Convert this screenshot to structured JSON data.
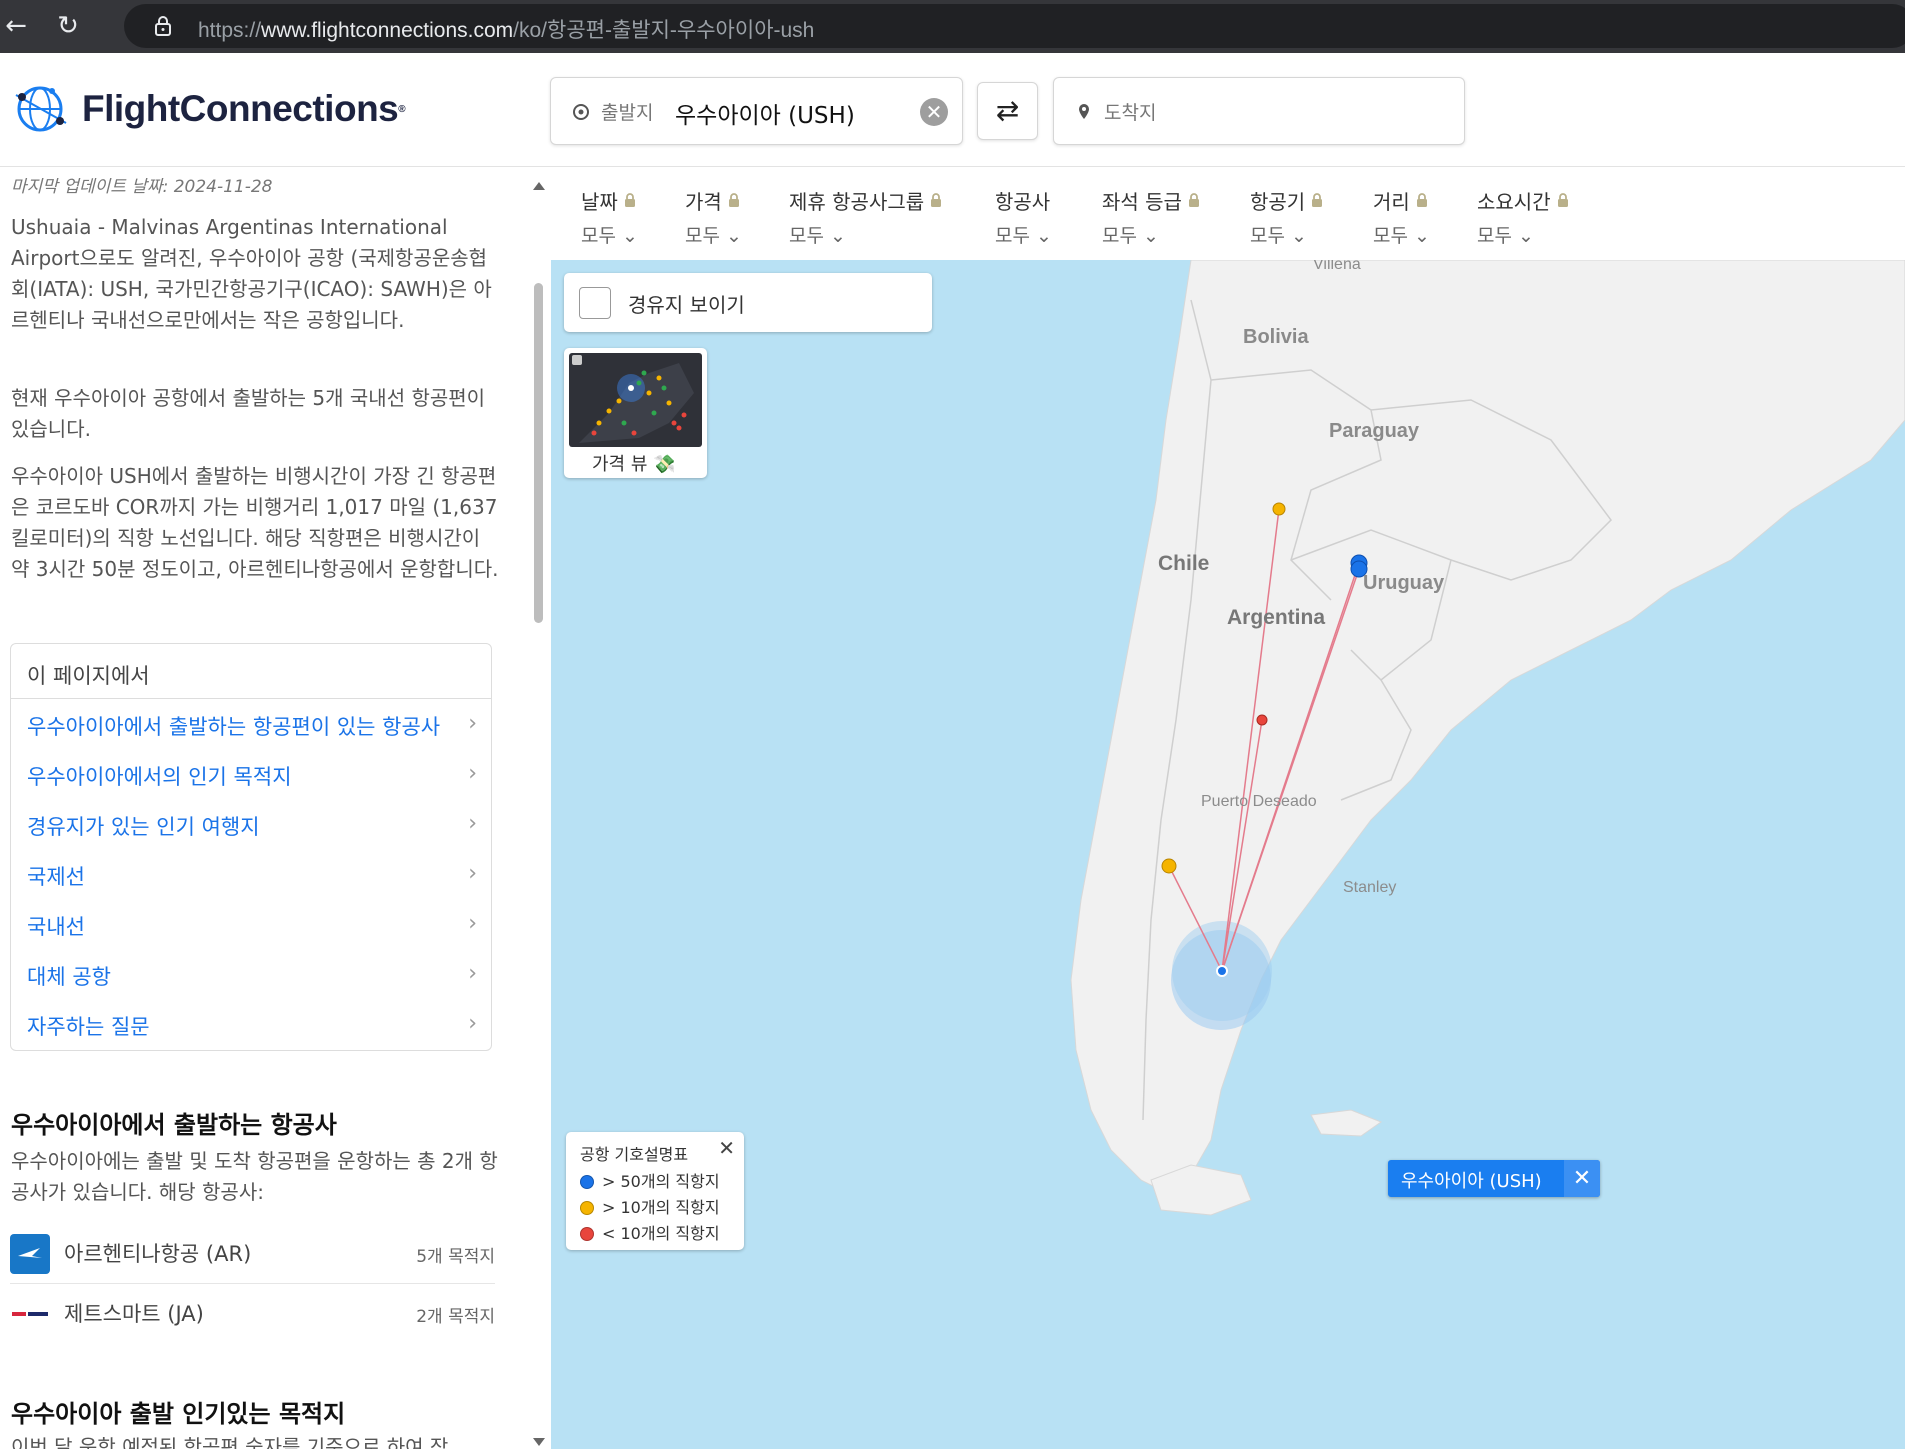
{
  "browser": {
    "url_prefix": "https://",
    "url_host": "www.flightconnections.com",
    "url_path": "/ko/항공편-출발지-우수아이아-ush"
  },
  "header": {
    "logo_text": "FlightConnections",
    "origin_label": "출발지",
    "origin_value": "우수아이아 (USH)",
    "destination_placeholder": "도착지"
  },
  "filters": [
    {
      "name": "날짜",
      "value": "모두",
      "locked": true
    },
    {
      "name": "가격",
      "value": "모두",
      "locked": true
    },
    {
      "name": "제휴 항공사그룹",
      "value": "모두",
      "locked": true
    },
    {
      "name": "항공사",
      "value": "모두",
      "locked": false
    },
    {
      "name": "좌석 등급",
      "value": "모두",
      "locked": true
    },
    {
      "name": "항공기",
      "value": "모두",
      "locked": true
    },
    {
      "name": "거리",
      "value": "모두",
      "locked": true
    },
    {
      "name": "소요시간",
      "value": "모두",
      "locked": true
    }
  ],
  "left": {
    "updated": "마지막 업데이트 날짜: 2024-11-28",
    "intro": "Ushuaia - Malvinas Argentinas International Airport으로도 알려진, 우수아이아 공항 (국제항공운송협회(IATA): USH, 국가민간항공기구(ICAO): SAWH)은 아르헨티나 국내선으로만에서는 작은 공항입니다.",
    "para2": "현재 우수아이아 공항에서 출발하는 5개 국내선 항공편이 있습니다.",
    "para3": "우수아이아 USH에서 출발하는 비행시간이 가장 긴 항공편은 코르도바 COR까지 가는 비행거리 1,017 마일 (1,637 킬로미터)의 직항 노선입니다. 해당 직항편은 비행시간이 약 3시간 50분 정도이고, 아르헨티나항공에서 운항합니다.",
    "toc_title": "이 페이지에서",
    "toc_items": [
      "우수아이아에서 출발하는 항공편이 있는 항공사",
      "우수아이아에서의 인기 목적지",
      "경유지가 있는 인기 여행지",
      "국제선",
      "국내선",
      "대체 공항",
      "자주하는 질문"
    ],
    "airlines_title": "우수아이아에서 출발하는 항공사",
    "airlines_desc": "우수아이아에는 출발 및 도착 항공편을 운항하는 총 2개 항공사가 있습니다. 해당 항공사:",
    "airlines": [
      {
        "name": "아르헨티나항공 (AR)",
        "count": "5개 목적지"
      },
      {
        "name": "제트스마트 (JA)",
        "count": "2개 목적지"
      }
    ],
    "destinations_title": "우수아이아 출발 인기있는 목적지",
    "destinations_desc": "이번 달 운항 예정된 항공편 숫자를 기준으로 하여 작"
  },
  "map": {
    "show_layovers": "경유지 보이기",
    "price_view": "가격 뷰 💸",
    "labels": {
      "villena": "Villena",
      "bolivia": "Bolivia",
      "paraguay": "Paraguay",
      "chile": "Chile",
      "argentina": "Argentina",
      "uruguay": "Uruguay",
      "puerto_deseado": "Puerto Deseado",
      "stanley": "Stanley"
    },
    "legend": {
      "title": "공항 기호설명표",
      "items": [
        {
          "label": "> 50개의 직항지",
          "color": "#1a73e8"
        },
        {
          "label": "> 10개의 직항지",
          "color": "#f5b400"
        },
        {
          "label": "< 10개의 직항지",
          "color": "#e8453c"
        }
      ]
    },
    "airport_tag": "우수아이아 (USH)"
  }
}
